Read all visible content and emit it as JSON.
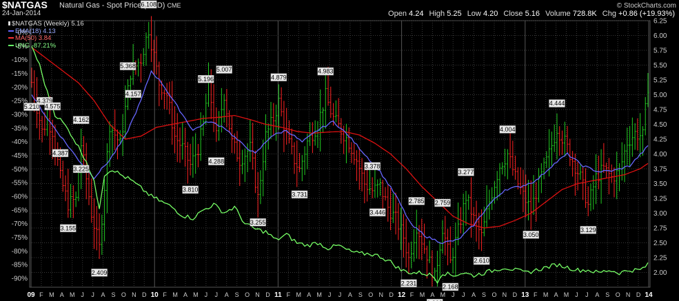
{
  "header": {
    "symbol": "$NATGAS",
    "description": "Natural Gas - Spot Price (EOD)",
    "exchange": "CME",
    "date": "24-Jan-2014",
    "brand": "© StockCharts.com",
    "open_label": "Open",
    "open": "4.24",
    "high_label": "High",
    "high": "5.25",
    "low_label": "Low",
    "low": "4.20",
    "close_label": "Close",
    "close": "5.16",
    "volume_label": "Volume",
    "volume": "728.8K",
    "chg_label": "Chg",
    "chg": "+0.86 (+19.93%)"
  },
  "legend": [
    {
      "text": "$NATGAS (Weekly) 5.16",
      "color": "#dddddd"
    },
    {
      "text": "EMA(18) 4.13",
      "color": "#6666ff"
    },
    {
      "text": "MA(50) 3.84",
      "color": "#ff3333"
    },
    {
      "text": "UNG -87.21%",
      "color": "#66ff66"
    }
  ],
  "colors": {
    "up": "#22cc22",
    "down": "#ff2222",
    "ema": "#6666ff",
    "ma": "#dd1111",
    "ung": "#77ff66",
    "grid": "#3a3a3a",
    "axis_text": "#cccccc"
  },
  "chart_data": {
    "type": "ohlc-line-overlay",
    "price_axis": {
      "min": 1.75,
      "max": 6.25,
      "ticks": [
        "2.00",
        "2.25",
        "2.50",
        "2.75",
        "3.00",
        "3.25",
        "3.50",
        "3.75",
        "4.00",
        "4.25",
        "4.50",
        "4.75",
        "5.00",
        "5.25",
        "5.50",
        "5.75",
        "6.00",
        "6.25"
      ]
    },
    "pct_axis": {
      "min": -90,
      "max": 0,
      "ticks": [
        "0%",
        "-5%",
        "-10%",
        "-15%",
        "-20%",
        "-25%",
        "-30%",
        "-35%",
        "-40%",
        "-45%",
        "-50%",
        "-55%",
        "-60%",
        "-65%",
        "-70%",
        "-75%",
        "-80%",
        "-85%",
        "-90%"
      ]
    },
    "x_ticks": [
      "09",
      "F",
      "M",
      "A",
      "M",
      "J",
      "J",
      "A",
      "S",
      "O",
      "N",
      "D",
      "10",
      "F",
      "M",
      "A",
      "M",
      "J",
      "J",
      "A",
      "S",
      "O",
      "N",
      "D",
      "11",
      "F",
      "M",
      "A",
      "M",
      "J",
      "J",
      "A",
      "S",
      "O",
      "N",
      "D",
      "12",
      "F",
      "M",
      "A",
      "M",
      "J",
      "J",
      "A",
      "S",
      "O",
      "N",
      "D",
      "13",
      "F",
      "M",
      "A",
      "M",
      "J",
      "J",
      "A",
      "S",
      "O",
      "N",
      "D",
      "14"
    ],
    "year_ticks": [
      "09",
      "10",
      "11",
      "12",
      "13",
      "14"
    ],
    "price_anchors": [
      [
        0,
        5.21
      ],
      [
        4,
        4.38
      ],
      [
        6,
        4.58
      ],
      [
        8,
        4.39
      ],
      [
        11,
        3.6
      ],
      [
        14,
        3.16
      ],
      [
        17,
        3.23
      ],
      [
        19,
        4.16
      ],
      [
        23,
        3.0
      ],
      [
        26,
        2.41
      ],
      [
        30,
        4.5
      ],
      [
        34,
        4.16
      ],
      [
        38,
        5.37
      ],
      [
        42,
        5.6
      ],
      [
        45,
        6.11
      ],
      [
        49,
        5.2
      ],
      [
        52,
        5.0
      ],
      [
        55,
        4.3
      ],
      [
        58,
        4.1
      ],
      [
        61,
        3.81
      ],
      [
        64,
        4.1
      ],
      [
        66,
        4.5
      ],
      [
        68,
        5.2
      ],
      [
        71,
        4.29
      ],
      [
        74,
        5.01
      ],
      [
        77,
        4.2
      ],
      [
        80,
        3.9
      ],
      [
        84,
        4.1
      ],
      [
        87,
        3.26
      ],
      [
        90,
        4.3
      ],
      [
        93,
        4.6
      ],
      [
        95,
        4.88
      ],
      [
        98,
        4.3
      ],
      [
        101,
        3.9
      ],
      [
        103,
        3.73
      ],
      [
        106,
        4.2
      ],
      [
        110,
        4.5
      ],
      [
        113,
        4.98
      ],
      [
        116,
        4.6
      ],
      [
        119,
        4.4
      ],
      [
        122,
        4.2
      ],
      [
        125,
        3.9
      ],
      [
        128,
        3.5
      ],
      [
        131,
        3.38
      ],
      [
        134,
        3.45
      ],
      [
        137,
        3.1
      ],
      [
        140,
        2.9
      ],
      [
        143,
        2.6
      ],
      [
        145,
        2.23
      ],
      [
        148,
        2.79
      ],
      [
        152,
        2.3
      ],
      [
        155,
        1.9
      ],
      [
        158,
        2.76
      ],
      [
        161,
        2.17
      ],
      [
        164,
        2.7
      ],
      [
        167,
        3.28
      ],
      [
        170,
        2.9
      ],
      [
        173,
        2.61
      ],
      [
        176,
        3.2
      ],
      [
        180,
        3.8
      ],
      [
        183,
        4.0
      ],
      [
        186,
        3.6
      ],
      [
        189,
        3.3
      ],
      [
        192,
        3.05
      ],
      [
        195,
        3.5
      ],
      [
        199,
        4.0
      ],
      [
        202,
        4.44
      ],
      [
        205,
        4.2
      ],
      [
        208,
        3.9
      ],
      [
        211,
        3.6
      ],
      [
        214,
        3.13
      ],
      [
        217,
        3.6
      ],
      [
        220,
        3.75
      ],
      [
        223,
        3.6
      ],
      [
        226,
        3.7
      ],
      [
        229,
        4.2
      ],
      [
        232,
        4.35
      ],
      [
        235,
        4.3
      ],
      [
        237,
        5.16
      ]
    ],
    "labels": [
      {
        "text": "5.210",
        "i": 0,
        "pos": "below"
      },
      {
        "text": "4.379",
        "i": 5,
        "pos": "above"
      },
      {
        "text": "4.575",
        "i": 8,
        "pos": "above"
      },
      {
        "text": "4.387",
        "i": 11,
        "pos": "above"
      },
      {
        "text": "3.155",
        "i": 14,
        "pos": "below"
      },
      {
        "text": "4.162",
        "i": 19,
        "pos": "above"
      },
      {
        "text": "3.225",
        "i": 19,
        "pos": "below"
      },
      {
        "text": "2.409",
        "i": 26,
        "pos": "below"
      },
      {
        "text": "5.368",
        "i": 37,
        "pos": "above"
      },
      {
        "text": "4.157",
        "i": 39,
        "pos": "below"
      },
      {
        "text": "6.108",
        "i": 45,
        "pos": "above"
      },
      {
        "text": "3.810",
        "i": 61,
        "pos": "below"
      },
      {
        "text": "5.196",
        "i": 67,
        "pos": "above"
      },
      {
        "text": "4.288",
        "i": 71,
        "pos": "below"
      },
      {
        "text": "5.007",
        "i": 74,
        "pos": "above"
      },
      {
        "text": "3.255",
        "i": 87,
        "pos": "below"
      },
      {
        "text": "4.879",
        "i": 95,
        "pos": "above"
      },
      {
        "text": "3.731",
        "i": 103,
        "pos": "below"
      },
      {
        "text": "4.983",
        "i": 113,
        "pos": "above"
      },
      {
        "text": "3.378",
        "i": 131,
        "pos": "above"
      },
      {
        "text": "3.446",
        "i": 133,
        "pos": "below"
      },
      {
        "text": "2.785",
        "i": 148,
        "pos": "above"
      },
      {
        "text": "2.231",
        "i": 145,
        "pos": "below"
      },
      {
        "text": "2.759",
        "i": 158,
        "pos": "above"
      },
      {
        "text": "1.902",
        "i": 155,
        "pos": "below"
      },
      {
        "text": "2.168",
        "i": 161,
        "pos": "below"
      },
      {
        "text": "3.277",
        "i": 167,
        "pos": "above"
      },
      {
        "text": "2.610",
        "i": 173,
        "pos": "below"
      },
      {
        "text": "4.004",
        "i": 183,
        "pos": "above"
      },
      {
        "text": "3.050",
        "i": 192,
        "pos": "below"
      },
      {
        "text": "4.444",
        "i": 202,
        "pos": "above"
      },
      {
        "text": "3.129",
        "i": 214,
        "pos": "below"
      }
    ],
    "ung_anchors": [
      [
        0,
        -5
      ],
      [
        3,
        -12
      ],
      [
        6,
        -22
      ],
      [
        9,
        -30
      ],
      [
        12,
        -33
      ],
      [
        15,
        -37
      ],
      [
        18,
        -42
      ],
      [
        21,
        -47
      ],
      [
        24,
        -55
      ],
      [
        26,
        -64
      ],
      [
        28,
        -52
      ],
      [
        31,
        -50
      ],
      [
        34,
        -52
      ],
      [
        38,
        -54
      ],
      [
        42,
        -57
      ],
      [
        46,
        -60
      ],
      [
        50,
        -62
      ],
      [
        54,
        -64
      ],
      [
        58,
        -67
      ],
      [
        62,
        -68
      ],
      [
        66,
        -65
      ],
      [
        70,
        -63
      ],
      [
        74,
        -66
      ],
      [
        78,
        -64
      ],
      [
        82,
        -70
      ],
      [
        86,
        -72
      ],
      [
        90,
        -73
      ],
      [
        94,
        -76
      ],
      [
        98,
        -74
      ],
      [
        102,
        -77
      ],
      [
        106,
        -78
      ],
      [
        110,
        -77
      ],
      [
        114,
        -79
      ],
      [
        118,
        -78
      ],
      [
        122,
        -80
      ],
      [
        126,
        -81
      ],
      [
        130,
        -81
      ],
      [
        134,
        -82
      ],
      [
        138,
        -84
      ],
      [
        142,
        -87
      ],
      [
        146,
        -88
      ],
      [
        150,
        -88
      ],
      [
        154,
        -89
      ],
      [
        156,
        -91
      ],
      [
        158,
        -88
      ],
      [
        162,
        -89
      ],
      [
        166,
        -88
      ],
      [
        170,
        -89
      ],
      [
        174,
        -88
      ],
      [
        178,
        -87
      ],
      [
        182,
        -86
      ],
      [
        186,
        -87
      ],
      [
        190,
        -88
      ],
      [
        194,
        -87
      ],
      [
        198,
        -86
      ],
      [
        202,
        -85
      ],
      [
        206,
        -86
      ],
      [
        210,
        -87
      ],
      [
        214,
        -87
      ],
      [
        218,
        -88
      ],
      [
        222,
        -87
      ],
      [
        226,
        -88
      ],
      [
        230,
        -87
      ],
      [
        234,
        -87
      ],
      [
        237,
        -85
      ]
    ],
    "ema_anchors": [
      [
        0,
        5.0
      ],
      [
        6,
        4.6
      ],
      [
        12,
        4.25
      ],
      [
        18,
        3.9
      ],
      [
        24,
        3.6
      ],
      [
        30,
        3.9
      ],
      [
        36,
        4.3
      ],
      [
        42,
        4.9
      ],
      [
        46,
        5.4
      ],
      [
        50,
        5.2
      ],
      [
        56,
        4.8
      ],
      [
        62,
        4.4
      ],
      [
        68,
        4.55
      ],
      [
        74,
        4.45
      ],
      [
        80,
        4.2
      ],
      [
        86,
        4.0
      ],
      [
        92,
        4.3
      ],
      [
        98,
        4.4
      ],
      [
        104,
        4.2
      ],
      [
        110,
        4.4
      ],
      [
        116,
        4.55
      ],
      [
        122,
        4.3
      ],
      [
        128,
        4.0
      ],
      [
        134,
        3.7
      ],
      [
        140,
        3.3
      ],
      [
        146,
        2.8
      ],
      [
        152,
        2.6
      ],
      [
        158,
        2.5
      ],
      [
        164,
        2.55
      ],
      [
        170,
        2.8
      ],
      [
        176,
        3.15
      ],
      [
        182,
        3.4
      ],
      [
        188,
        3.45
      ],
      [
        194,
        3.55
      ],
      [
        200,
        3.8
      ],
      [
        206,
        4.0
      ],
      [
        212,
        3.8
      ],
      [
        218,
        3.7
      ],
      [
        224,
        3.72
      ],
      [
        230,
        3.8
      ],
      [
        237,
        4.13
      ]
    ],
    "ma_anchors": [
      [
        0,
        5.8
      ],
      [
        6,
        5.6
      ],
      [
        12,
        5.4
      ],
      [
        18,
        5.2
      ],
      [
        24,
        4.9
      ],
      [
        30,
        4.5
      ],
      [
        36,
        4.25
      ],
      [
        42,
        4.3
      ],
      [
        48,
        4.45
      ],
      [
        54,
        4.5
      ],
      [
        60,
        4.55
      ],
      [
        66,
        4.6
      ],
      [
        72,
        4.62
      ],
      [
        78,
        4.65
      ],
      [
        84,
        4.58
      ],
      [
        90,
        4.5
      ],
      [
        96,
        4.45
      ],
      [
        102,
        4.38
      ],
      [
        108,
        4.35
      ],
      [
        114,
        4.37
      ],
      [
        120,
        4.38
      ],
      [
        126,
        4.32
      ],
      [
        132,
        4.18
      ],
      [
        138,
        4.0
      ],
      [
        144,
        3.75
      ],
      [
        150,
        3.45
      ],
      [
        156,
        3.2
      ],
      [
        162,
        2.95
      ],
      [
        168,
        2.82
      ],
      [
        174,
        2.75
      ],
      [
        180,
        2.78
      ],
      [
        186,
        2.88
      ],
      [
        192,
        3.0
      ],
      [
        198,
        3.2
      ],
      [
        204,
        3.4
      ],
      [
        210,
        3.5
      ],
      [
        216,
        3.55
      ],
      [
        222,
        3.6
      ],
      [
        228,
        3.65
      ],
      [
        234,
        3.75
      ],
      [
        237,
        3.84
      ]
    ]
  }
}
